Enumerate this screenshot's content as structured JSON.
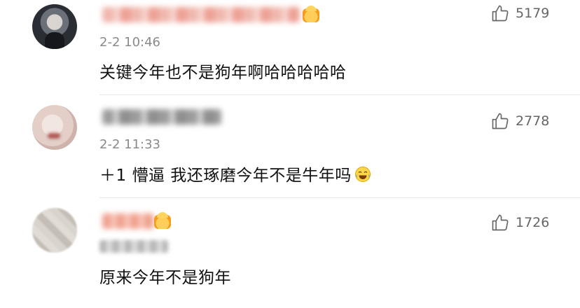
{
  "comments": [
    {
      "timestamp": "2-2 10:46",
      "text": "关键今年也不是狗年啊哈哈哈哈哈",
      "likes": "5179",
      "username_blurred": true,
      "avatar_icon": "avatar-dark-photo",
      "badge_icon": "vip-crown-icon"
    },
    {
      "timestamp": "2-2 11:33",
      "text": "＋1 懵逼  我还琢磨今年不是牛年吗",
      "emoji": "laughing-tears-emoji",
      "likes": "2778",
      "username_blurred": true,
      "avatar_icon": "avatar-light-photo"
    },
    {
      "timestamp_blurred": true,
      "text": "原来今年不是狗年",
      "likes": "1726",
      "username_blurred": true,
      "avatar_icon": "avatar-blurred-photo",
      "badge_icon": "vip-crown-icon"
    }
  ],
  "icons": {
    "like": "thumbs-up-icon"
  }
}
